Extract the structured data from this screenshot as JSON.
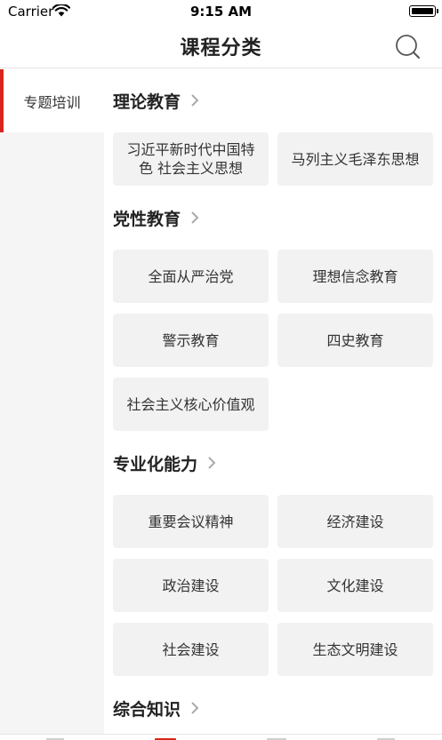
{
  "status_bar": {
    "carrier": "Carrier",
    "time": "9:15 AM"
  },
  "header": {
    "title": "课程分类",
    "search_icon": "search-icon"
  },
  "sidebar": {
    "items": [
      {
        "label": "专题培训",
        "active": true
      }
    ],
    "accent_color": "#d9261c"
  },
  "sections": [
    {
      "title": "理论教育",
      "items": [
        "习近平新时代中国特色 社会主义思想",
        "马列主义毛泽东思想"
      ]
    },
    {
      "title": "党性教育",
      "items": [
        "全面从严治党",
        "理想信念教育",
        "警示教育",
        "四史教育",
        "社会主义核心价值观"
      ]
    },
    {
      "title": "专业化能力",
      "items": [
        "重要会议精神",
        "经济建设",
        "政治建设",
        "文化建设",
        "社会建设",
        "生态文明建设"
      ]
    },
    {
      "title": "综合知识",
      "items": []
    }
  ]
}
